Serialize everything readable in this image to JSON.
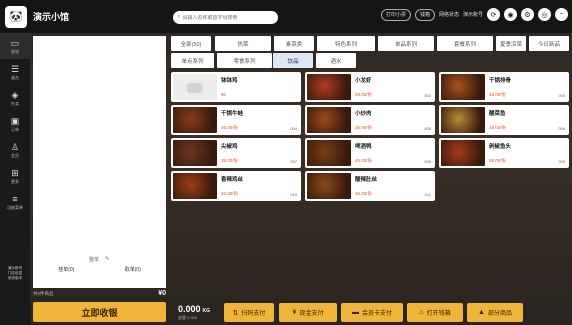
{
  "app": {
    "shop_name": "演示小馆",
    "logo_icon": "panda-logo-icon"
  },
  "search": {
    "placeholder": "请输入名称或首字母搜索"
  },
  "topbar": {
    "print_label": "打印小票",
    "cash_label": "钱箱",
    "network_label": "网络状态",
    "user_label": "演示账号"
  },
  "nav": [
    {
      "icon": "▭",
      "label": "收银"
    },
    {
      "icon": "☰",
      "label": "桌台"
    },
    {
      "icon": "◈",
      "label": "外卖"
    },
    {
      "icon": "▣",
      "label": "订单"
    },
    {
      "icon": "♙",
      "label": "会员"
    },
    {
      "icon": "⊞",
      "label": "更多"
    },
    {
      "icon": "≡",
      "label": "功能菜单"
    }
  ],
  "nav_footer": "演示账号\n门店信息\n系统版本",
  "order_panel": {
    "tools_label": "整单",
    "edit_icon": "edit-icon",
    "action_left": "挂单(0)",
    "action_right": "取单(0)",
    "count_label": "共0件商品",
    "total": "¥0",
    "checkout_label": "立即收银"
  },
  "categories": [
    {
      "label": "全部(50)",
      "active": false
    },
    {
      "label": "热菜",
      "active": false
    },
    {
      "label": "素菜类",
      "active": false
    },
    {
      "label": "特色系列",
      "active": false
    },
    {
      "label": "单品系列",
      "active": false
    },
    {
      "label": "套餐系列",
      "active": false
    },
    {
      "label": "夏季凉菜",
      "active": false
    },
    {
      "label": "今日新品",
      "active": false
    },
    {
      "label": "单点系列",
      "active": false
    },
    {
      "label": "零食系列",
      "active": false
    },
    {
      "label": "饮品",
      "active": true
    },
    {
      "label": "酒水",
      "active": false
    }
  ],
  "dishes": [
    {
      "name": "钵钵鸡",
      "price": "¥0",
      "code": "",
      "color": "#e8e8e8"
    },
    {
      "name": "小龙虾",
      "price": "38.00/份",
      "code": "002",
      "color": "#b13a22"
    },
    {
      "name": "干锅排骨",
      "price": "48.00/份",
      "code": "003",
      "color": "#a5521f"
    },
    {
      "name": "干锅牛蛙",
      "price": "46.00/份",
      "code": "004",
      "color": "#8b3a1c"
    },
    {
      "name": "小炒肉",
      "price": "35.00/份",
      "code": "005",
      "color": "#9a4a18"
    },
    {
      "name": "酸菜鱼",
      "price": "48.00/份",
      "code": "006",
      "color": "#b88a3a"
    },
    {
      "name": "尖椒鸡",
      "price": "39.00/份",
      "code": "007",
      "color": "#6b3520"
    },
    {
      "name": "啤酒鸭",
      "price": "45.00/份",
      "code": "008",
      "color": "#7a3d18"
    },
    {
      "name": "剁椒鱼头",
      "price": "58.00/份",
      "code": "009",
      "color": "#a83a1a"
    },
    {
      "name": "香辣鸡丝",
      "price": "32.00/份",
      "code": "010",
      "color": "#9c3e16"
    },
    {
      "name": "酸辣肚丝",
      "price": "36.00/份",
      "code": "011",
      "color": "#8a4a1a"
    }
  ],
  "scale": {
    "weight": "0.000",
    "unit": "KG",
    "tare": "皮重 0.000"
  },
  "payments": [
    {
      "icon": "⇅",
      "label": "扫码支付"
    },
    {
      "icon": "¥",
      "label": "现金支付"
    },
    {
      "icon": "▬",
      "label": "会员卡支付"
    },
    {
      "icon": "⌂",
      "label": "打开钱箱"
    },
    {
      "icon": "▲",
      "label": "部分商品"
    }
  ],
  "colors": {
    "accent": "#f1b43a",
    "price": "#e0522a",
    "active_cat": "#dde6f2"
  }
}
